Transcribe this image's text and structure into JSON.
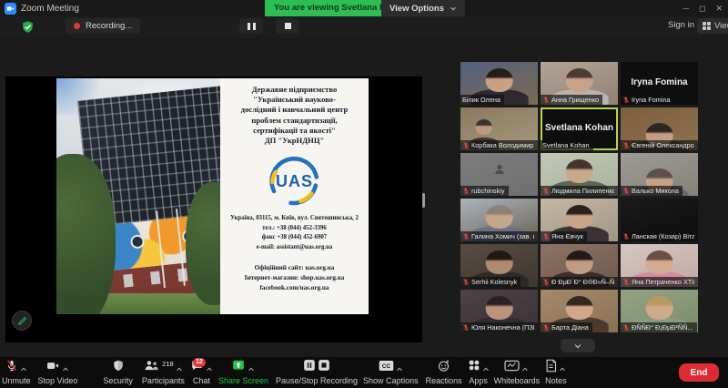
{
  "titlebar": {
    "app_title": "Zoom Meeting",
    "banner": "You are viewing Svetlana Kohan's screen",
    "view_options": "View Options"
  },
  "topbar": {
    "recording_label": "Recording...",
    "sign_in": "Sign in",
    "view_label": "View"
  },
  "slide": {
    "org_lines": [
      "Державне підприємство",
      "\"Український науково-",
      "дослідний і навчальний центр",
      "проблем стандартизації,",
      "сертифікації та якості\"",
      "ДП \"УкрНДНЦ\""
    ],
    "logo_text": "UAS",
    "address_lines": [
      "Україна, 03115, м. Київ,  вул. Святошинська, 2",
      "тел.:  +38 (044) 452-3396",
      "факс  +38 (044) 452-6907",
      "e-mail: assistant@uas.org.ua"
    ],
    "site_lines": [
      "Офіційний сайт: uas.org.ua",
      "Інтернет-магазин: shop.uas.org.ua",
      "facebook.com/uas.org.ua"
    ]
  },
  "participants": {
    "tiles": [
      {
        "name": "Білик Олена",
        "muted": false,
        "kind": "video",
        "bg": [
          "#54617d",
          "#7a6a52"
        ],
        "hair": "#241d1c",
        "skin": "#caa184",
        "top": "#2e2a30"
      },
      {
        "name": "Анна Грищенко",
        "muted": true,
        "kind": "video",
        "bg": [
          "#b3a596",
          "#8f8173"
        ],
        "hair": "#4a3b33",
        "skin": "#c8a289",
        "top": "#b9b3a9"
      },
      {
        "name": "Iryna Fomina",
        "muted": true,
        "kind": "nameplate"
      },
      {
        "name": "Корбака Володимир...",
        "muted": true,
        "kind": "video",
        "fig": "left",
        "bg": [
          "#8d7a5d",
          "#a3977f"
        ],
        "hair": "#3a3330",
        "skin": "#b99a80",
        "top": "#41352c"
      },
      {
        "name": "Svetlana Kohan",
        "muted": false,
        "kind": "nameplate",
        "active": true
      },
      {
        "name": "Євгеній Олександров...",
        "muted": true,
        "kind": "video",
        "fig": "low",
        "bg": [
          "#7c5f3d",
          "#8f7351"
        ],
        "hair": "#2e2620",
        "skin": "#c49e82",
        "top": "#4a3d30"
      },
      {
        "name": "rubchinskiy",
        "muted": true,
        "kind": "avatar",
        "bg": [
          "#7d7d7d",
          "#6f6f6f"
        ]
      },
      {
        "name": "Людмила Пилипенко",
        "muted": true,
        "kind": "video",
        "bg": [
          "#c2c8b8",
          "#a8b29a"
        ],
        "hair": "#44342e",
        "skin": "#c8a98c",
        "top": "#5c6657"
      },
      {
        "name": "Валько Микола",
        "muted": true,
        "kind": "video",
        "fig": "low",
        "bg": [
          "#9c9a94",
          "#858379"
        ],
        "hair": "#5a5248",
        "skin": "#c2a184",
        "top": "#6b6a62"
      },
      {
        "name": "Галина Хомич (зав. ка...",
        "muted": true,
        "kind": "video",
        "bg": [
          "#aab4bc",
          "#6d6257"
        ],
        "hair": "#8c8276",
        "skin": "#c6a68a",
        "top": "#6b7280"
      },
      {
        "name": "Яна Євчук",
        "muted": true,
        "kind": "video",
        "bg": [
          "#c4b8a4",
          "#a19684"
        ],
        "hair": "#2b211e",
        "skin": "#c9a488",
        "top": "#3a3233"
      },
      {
        "name": "Ланская (Козар) Віта",
        "muted": true,
        "kind": "dark",
        "bg": [
          "#1a1a1a",
          "#0d0d0d"
        ]
      },
      {
        "name": "Serhii Kolesnyk",
        "muted": true,
        "kind": "video",
        "bg": [
          "#564c42",
          "#3f3831"
        ],
        "hair": "#1f1a16",
        "skin": "#b08a6e",
        "top": "#2e2a26"
      },
      {
        "name": "Ð ÐµÐ´Ð° Ð®Ð»Ñ–Ñ",
        "muted": true,
        "kind": "video",
        "bg": [
          "#8c7263",
          "#6e5a4e"
        ],
        "hair": "#221a18",
        "skin": "#c29c82",
        "top": "#3a2e2a"
      },
      {
        "name": "Яна Петраченко ХТіБ...",
        "muted": true,
        "kind": "video",
        "bg": [
          "#d6c6c2",
          "#c2a8a4"
        ],
        "hair": "#6b4f43",
        "skin": "#d2ab90",
        "top": "#d58ca0"
      },
      {
        "name": "Юля Наконечна (ПЗВ...",
        "muted": true,
        "kind": "video",
        "bg": [
          "#4d4347",
          "#3a3236"
        ],
        "hair": "#2a2124",
        "skin": "#b9937a",
        "top": "#332c30"
      },
      {
        "name": "Барта Діана",
        "muted": true,
        "kind": "video",
        "bg": [
          "#a58a68",
          "#8a7155"
        ],
        "hair": "#33281f",
        "skin": "#cfa88a",
        "top": "#4a3b2e"
      },
      {
        "name": "ÐÑÑÐ° Ð¡ÐµÐ²ÑÑ...",
        "muted": true,
        "kind": "video",
        "bg": [
          "#93a383",
          "#7b8c6c"
        ],
        "hair": "#b99a5e",
        "skin": "#cfa98c",
        "top": "#8a9a7a"
      }
    ]
  },
  "toolbar": {
    "end_label": "End",
    "items": [
      {
        "key": "unmute",
        "label": "Unmute",
        "icon": "mic-muted",
        "chevron": true
      },
      {
        "key": "stop-video",
        "label": "Stop Video",
        "icon": "camera",
        "chevron": true
      },
      {
        "key": "security",
        "label": "Security",
        "icon": "shield",
        "chevron": false
      },
      {
        "key": "participants",
        "label": "Participants",
        "icon": "people",
        "chevron": true,
        "count": "218"
      },
      {
        "key": "chat",
        "label": "Chat",
        "icon": "chat",
        "chevron": true,
        "badge": "12"
      },
      {
        "key": "share-screen",
        "label": "Share Screen",
        "icon": "share",
        "chevron": true,
        "accent": "#23c04a"
      },
      {
        "key": "pause-stop-recording",
        "label": "Pause/Stop Recording",
        "icon": "rec",
        "chevron": false
      },
      {
        "key": "show-captions",
        "label": "Show Captions",
        "icon": "cc",
        "chevron": true
      },
      {
        "key": "reactions",
        "label": "Reactions",
        "icon": "smiley",
        "chevron": false
      },
      {
        "key": "apps",
        "label": "Apps",
        "icon": "apps",
        "chevron": true
      },
      {
        "key": "whiteboards",
        "label": "Whiteboards",
        "icon": "whiteboard",
        "chevron": true
      },
      {
        "key": "notes",
        "label": "Notes",
        "icon": "notes",
        "chevron": true
      }
    ]
  }
}
